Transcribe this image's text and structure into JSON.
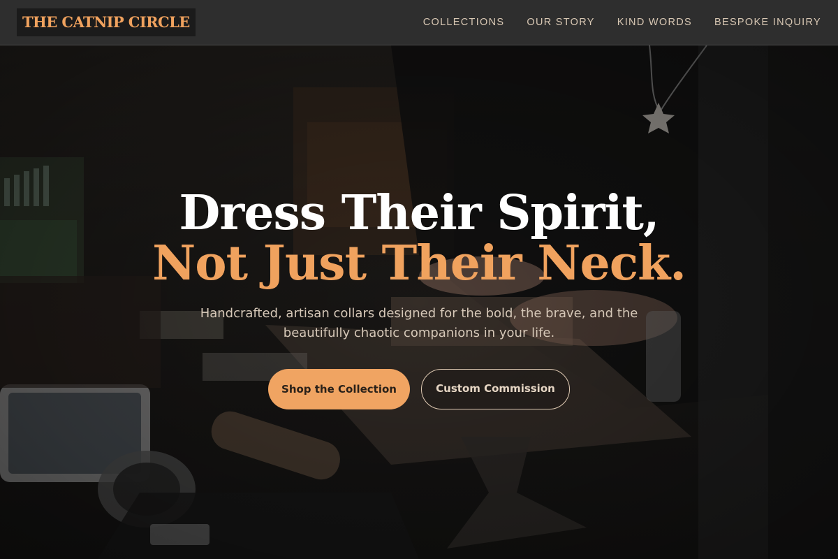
{
  "brand": {
    "logo_text": "THE CATNIP CIRCLE",
    "accent_color": "#f0a25e"
  },
  "nav": {
    "items": [
      {
        "label": "COLLECTIONS"
      },
      {
        "label": "OUR STORY"
      },
      {
        "label": "KIND WORDS"
      },
      {
        "label": "BESPOKE INQUIRY"
      }
    ]
  },
  "hero": {
    "headline_line1": "Dress Their Spirit,",
    "headline_line2": "Not Just Their Neck.",
    "subtext": "Handcrafted, artisan collars designed for the bold, the brave, and the beautifully chaotic companions in your life.",
    "primary_button": "Shop the Collection",
    "secondary_button": "Custom Commission"
  }
}
